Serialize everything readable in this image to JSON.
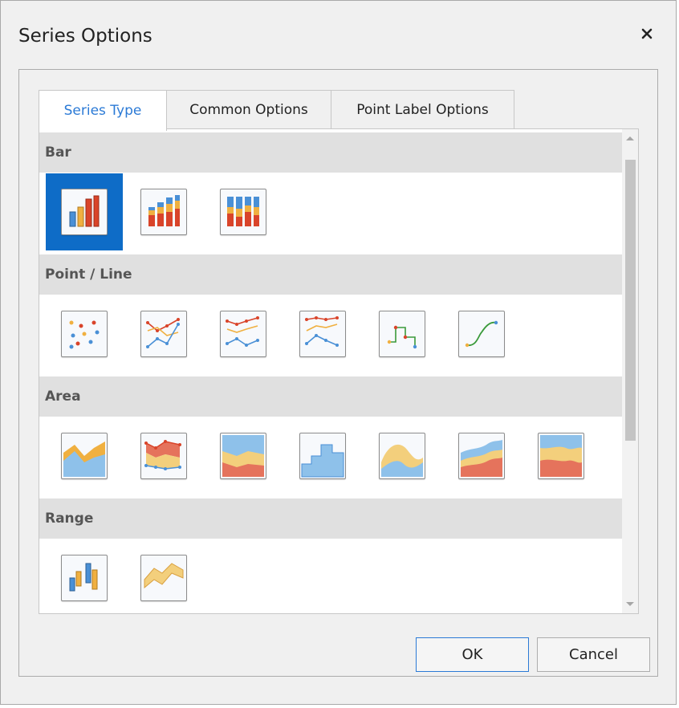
{
  "dialog": {
    "title": "Series Options",
    "close_icon": "close-icon"
  },
  "tabs": [
    {
      "label": "Series Type",
      "active": true
    },
    {
      "label": "Common Options",
      "active": false
    },
    {
      "label": "Point Label Options",
      "active": false
    }
  ],
  "sections": [
    {
      "label": "Bar",
      "icons": [
        "bar-icon",
        "stacked-bar-icon",
        "full-stacked-bar-icon"
      ],
      "selected_index": 0
    },
    {
      "label": "Point / Line",
      "icons": [
        "point-icon",
        "line-icon",
        "stacked-line-icon",
        "full-stacked-line-icon",
        "step-line-icon",
        "spline-icon"
      ]
    },
    {
      "label": "Area",
      "icons": [
        "area-icon",
        "stacked-area-marker-icon",
        "stacked-area-icon",
        "step-area-icon",
        "spline-area-icon",
        "stacked-spline-area-icon",
        "full-stacked-area-icon"
      ]
    },
    {
      "label": "Range",
      "icons": [
        "range-bar-icon",
        "range-area-icon"
      ]
    }
  ],
  "buttons": {
    "ok": "OK",
    "cancel": "Cancel"
  },
  "colors": {
    "accent": "#0e6cc7",
    "tab_active_text": "#2b7ad6",
    "section_header_bg": "#e0e0e0",
    "series_blue": "#4a90d6",
    "series_red": "#d9442a",
    "series_orange": "#f0b040"
  }
}
